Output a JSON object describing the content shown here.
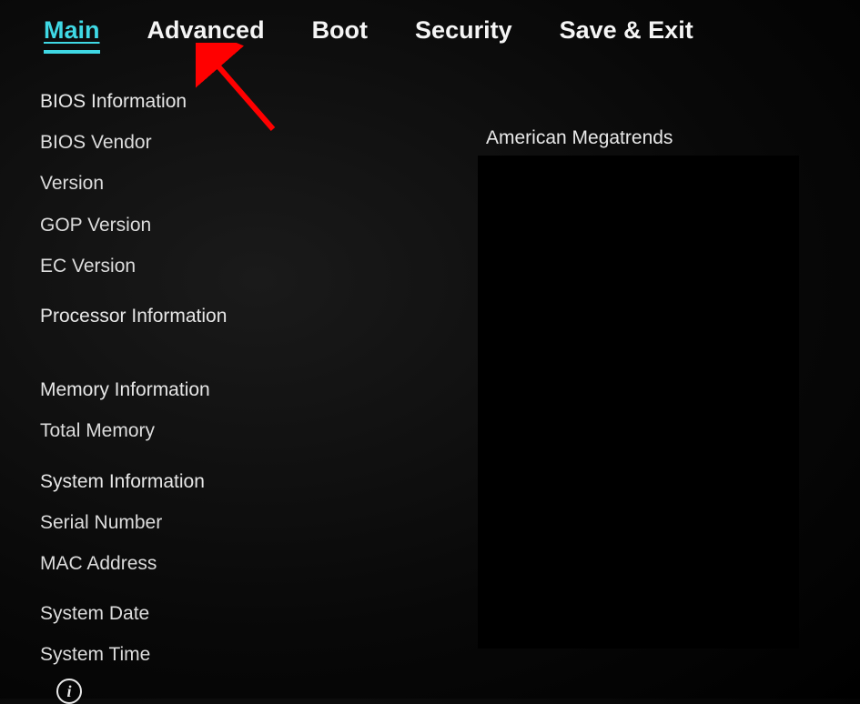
{
  "tabs": {
    "main": "Main",
    "advanced": "Advanced",
    "boot": "Boot",
    "security": "Security",
    "save_exit": "Save & Exit"
  },
  "labels": {
    "bios_information": "BIOS Information",
    "bios_vendor": "BIOS Vendor",
    "version": "Version",
    "gop_version": "GOP Version",
    "ec_version": "EC Version",
    "processor_information": "Processor Information",
    "memory_information": "Memory Information",
    "total_memory": "Total Memory",
    "system_information": "System Information",
    "serial_number": "Serial Number",
    "mac_address": "MAC Address",
    "system_date": "System Date",
    "system_time": "System Time"
  },
  "values": {
    "bios_vendor": "American Megatrends"
  }
}
